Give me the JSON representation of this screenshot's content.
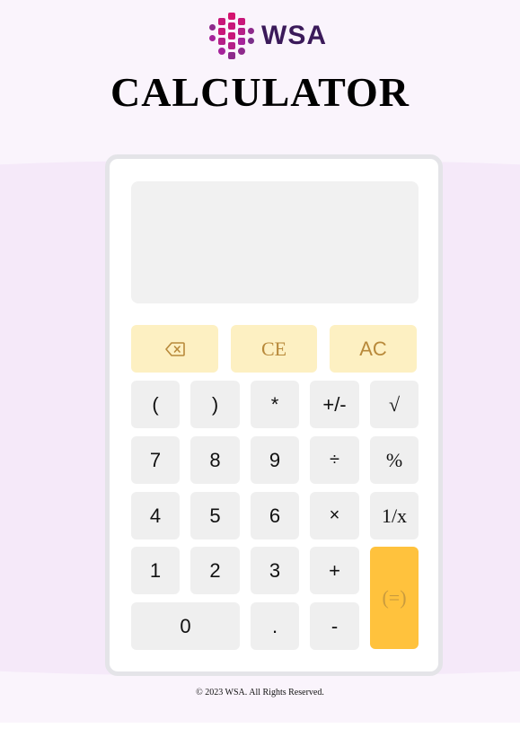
{
  "brand": {
    "name": "WSA"
  },
  "title": "CALCULATOR",
  "display": {
    "value": ""
  },
  "buttons": {
    "backspace": {
      "icon": "backspace-icon"
    },
    "ce": "CE",
    "ac": "AC",
    "open_paren": "(",
    "close_paren": ")",
    "multiply_star": "*",
    "plus_minus": "+/-",
    "sqrt": "√",
    "seven": "7",
    "eight": "8",
    "nine": "9",
    "divide": "÷",
    "percent": "%",
    "four": "4",
    "five": "5",
    "six": "6",
    "times": "×",
    "reciprocal": "1/x",
    "one": "1",
    "two": "2",
    "three": "3",
    "plus": "+",
    "equals": "(=)",
    "zero": "0",
    "decimal": ".",
    "minus": "-"
  },
  "colors": {
    "accent": "#ffc23d",
    "function_key": "#fdf0c2",
    "function_text": "#b8893a",
    "key": "#efefef",
    "brand_magenta": "#c8177a",
    "brand_purple": "#3b1a5a"
  },
  "footer": {
    "copyright": "© 2023 WSA. All Rights Reserved."
  }
}
